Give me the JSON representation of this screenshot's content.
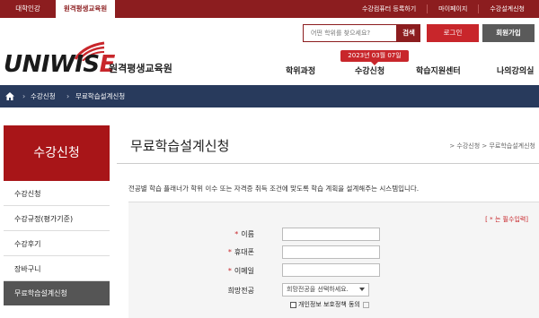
{
  "topbar": {
    "tabs": [
      "대학인강",
      "원격평생교육원"
    ],
    "links": [
      "수강컴퓨터 등록하기",
      "마이페이지",
      "수강설계신청"
    ]
  },
  "search": {
    "placeholder": "어떤 학위를 찾으세요?",
    "button": "검색"
  },
  "auth": {
    "login": "로그인",
    "join": "회원가입"
  },
  "logo": {
    "word_a": "UNIWIS",
    "word_b": "E",
    "sub": "원격평생교육원"
  },
  "nav": {
    "items": [
      "학위과정",
      "수강신청",
      "학습지원센터",
      "나의강의실"
    ],
    "date_badge": "2023년 03월 07일"
  },
  "breadcrumb": {
    "items": [
      "수강신청",
      "무료학습설계신청"
    ]
  },
  "sidebar": {
    "title": "수강신청",
    "items": [
      "수강신청",
      "수강규정(평가기준)",
      "수강후기",
      "장바구니",
      "무료학습설계신청"
    ]
  },
  "main": {
    "title": "무료학습설계신청",
    "crumb": "> 수강신청 > 무료학습설계신청",
    "description": "전공별 학습 플래너가 학위 이수 또는 자격증 취득 조건에 맞도록 학습 계획을 설계해주는 시스템입니다.",
    "required_note": "[ * 는 필수입력]",
    "required_star": "*",
    "fields": {
      "name": "이름",
      "phone": "휴대폰",
      "email": "이메일",
      "major": "희망전공"
    },
    "major_select": "희망전공을 선택하세요.",
    "privacy": "개인정보 보호정책 동의"
  },
  "colors": {
    "brand": "#8c1d1f",
    "accent": "#c8262b",
    "navy": "#283a5c"
  },
  "icons": [
    "home-icon",
    "chevron-right-icon",
    "checkbox-icon",
    "external-link-icon",
    "select-arrow-icon"
  ]
}
